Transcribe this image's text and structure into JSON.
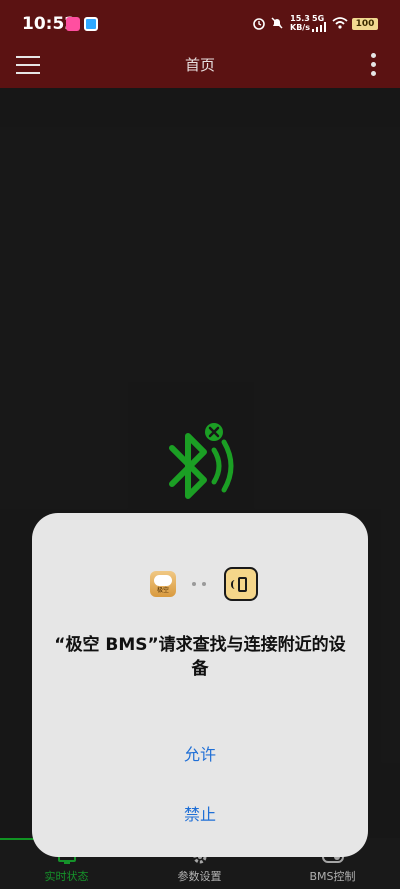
{
  "status_bar": {
    "time": "10:52",
    "net_speed_value": "15.3",
    "net_speed_unit": "KB/s",
    "signal": "5G",
    "battery": "100"
  },
  "app_bar": {
    "title": "首页",
    "menu_icon": "hamburger-menu-icon",
    "more_icon": "more-vertical-icon"
  },
  "center_icon": "bluetooth-disconnected-icon",
  "bottom_nav": {
    "items": [
      {
        "label": "实时状态",
        "icon": "monitor-icon",
        "active": true
      },
      {
        "label": "参数设置",
        "icon": "gear-icon",
        "active": false
      },
      {
        "label": "BMS控制",
        "icon": "toggle-icon",
        "active": false
      }
    ]
  },
  "dialog": {
    "app_logo_text": "极空",
    "title": "“极空 BMS”请求查找与连接附近的设备",
    "allow_label": "允许",
    "deny_label": "禁止"
  },
  "colors": {
    "appbar_bg": "#5b1212",
    "accent_green": "#19a830",
    "dialog_button_blue": "#1f6fd6"
  }
}
